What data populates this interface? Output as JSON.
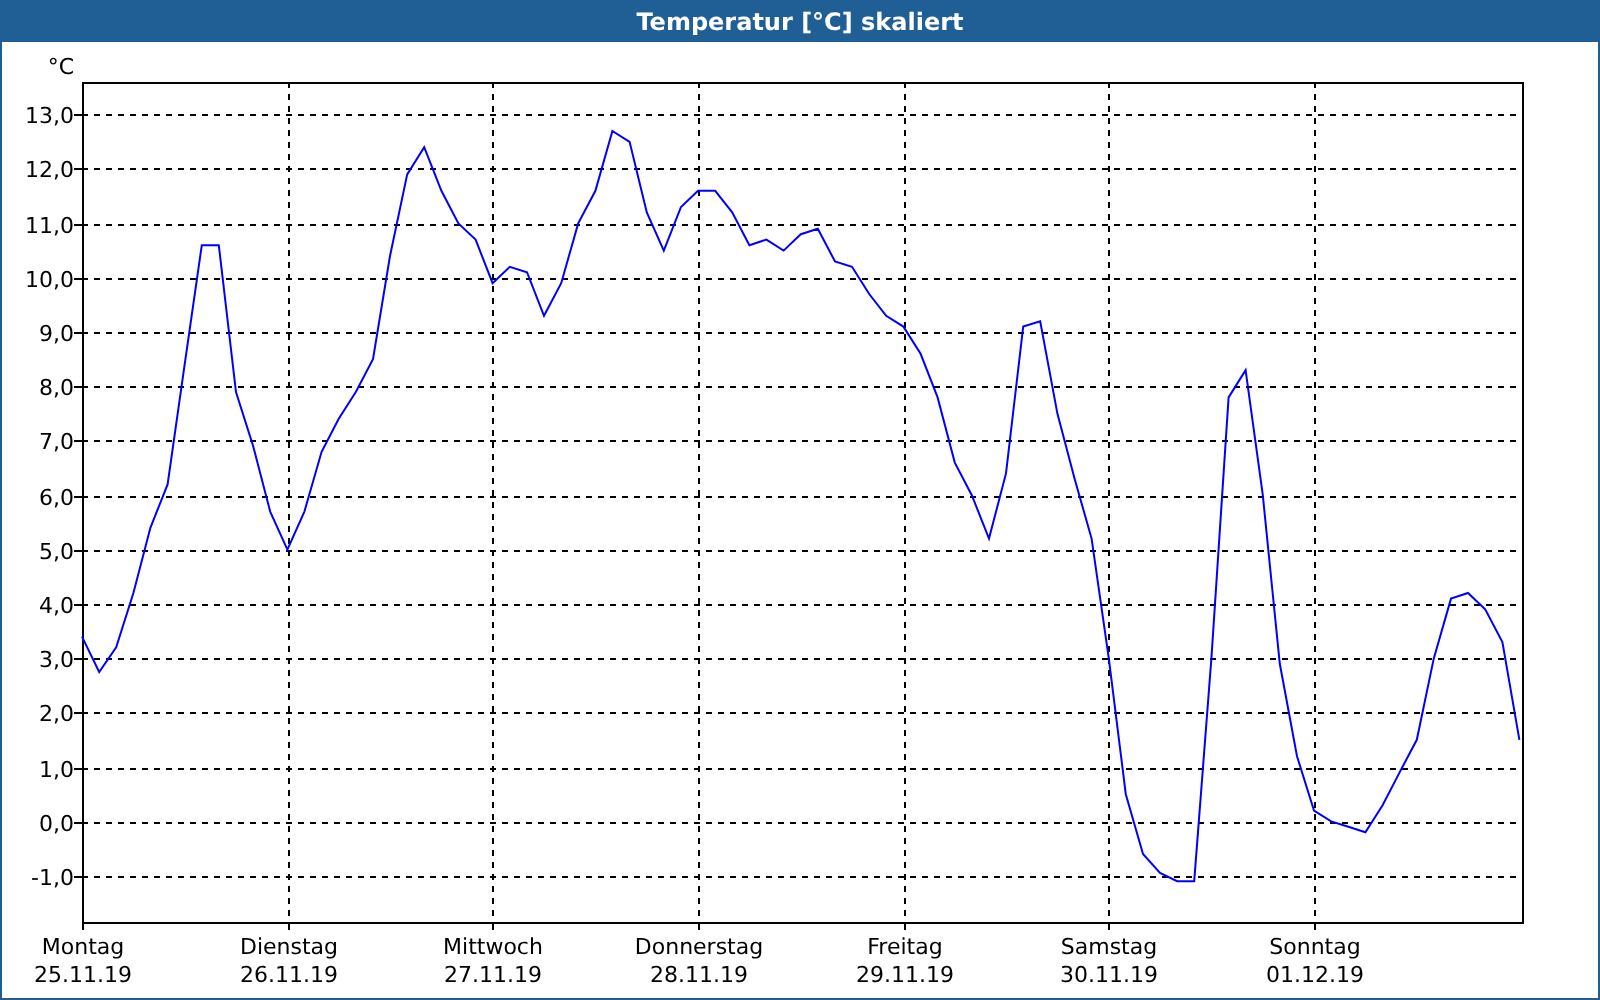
{
  "window": {
    "title": "Temperatur [°C] skaliert"
  },
  "chart": {
    "chart_data": {
      "type": "line",
      "ylabel": "°C",
      "grid": true,
      "categories": [
        "Montag 25.11.19",
        null,
        null,
        null,
        null,
        null,
        null,
        null,
        null,
        null,
        null,
        null,
        "Dienstag 26.11.19",
        null,
        null,
        null,
        null,
        null,
        null,
        null,
        null,
        null,
        null,
        null,
        "Mittwoch 27.11.19",
        null,
        null,
        null,
        null,
        null,
        null,
        null,
        null,
        null,
        null,
        null,
        "Donnerstag 28.11.19",
        null,
        null,
        null,
        null,
        null,
        null,
        null,
        null,
        null,
        null,
        null,
        "Freitag 29.11.19",
        null,
        null,
        null,
        null,
        null,
        null,
        null,
        null,
        null,
        null,
        null,
        "Samstag 30.11.19",
        null,
        null,
        null,
        null,
        null,
        null,
        null,
        null,
        null,
        null,
        null,
        "Sonntag 01.12.19",
        null,
        null,
        null,
        null,
        null,
        null,
        null,
        null,
        null,
        null,
        null,
        null
      ],
      "series": [
        {
          "color": "#0000ff",
          "values": [
            3.4,
            2.75,
            3.2,
            4.2,
            5.4,
            6.2,
            8.4,
            10.6,
            10.6,
            7.9,
            6.9,
            5.7,
            5.0,
            5.7,
            6.8,
            7.4,
            7.9,
            8.5,
            10.4,
            11.9,
            12.4,
            11.6,
            11.0,
            10.7,
            9.9,
            10.2,
            10.1,
            9.3,
            9.9,
            11.0,
            11.6,
            12.7,
            12.5,
            11.2,
            10.5,
            11.3,
            11.6,
            11.6,
            11.2,
            10.6,
            10.7,
            10.5,
            10.8,
            10.9,
            10.3,
            10.2,
            9.7,
            9.3,
            9.1,
            8.6,
            7.8,
            6.6,
            6.0,
            5.2,
            6.4,
            9.1,
            9.2,
            7.5,
            6.3,
            5.2,
            3.0,
            0.5,
            -0.6,
            -0.95,
            -1.1,
            -1.1,
            3.0,
            7.8,
            8.3,
            6.0,
            2.9,
            1.2,
            0.2,
            0.0,
            -0.1,
            -0.2,
            0.3,
            0.9,
            1.5,
            3.0,
            4.1,
            4.2,
            3.9,
            3.3,
            1.5
          ]
        }
      ],
      "ylim": [
        -1.85,
        13.6
      ],
      "yticks": [
        {
          "value": -1,
          "label": "-1,0"
        },
        {
          "value": 0,
          "label": "0,0"
        },
        {
          "value": 1,
          "label": "1,0"
        },
        {
          "value": 2,
          "label": "2,0"
        },
        {
          "value": 3,
          "label": "3,0"
        },
        {
          "value": 4,
          "label": "4,0"
        },
        {
          "value": 5,
          "label": "5,0"
        },
        {
          "value": 6,
          "label": "6,0"
        },
        {
          "value": 7,
          "label": "7,0"
        },
        {
          "value": 8,
          "label": "8,0"
        },
        {
          "value": 9,
          "label": "9,0"
        },
        {
          "value": 10,
          "label": "10,0"
        },
        {
          "value": 11,
          "label": "11,0"
        },
        {
          "value": 12,
          "label": "12,0"
        },
        {
          "value": 13,
          "label": "13,0"
        }
      ]
    }
  }
}
